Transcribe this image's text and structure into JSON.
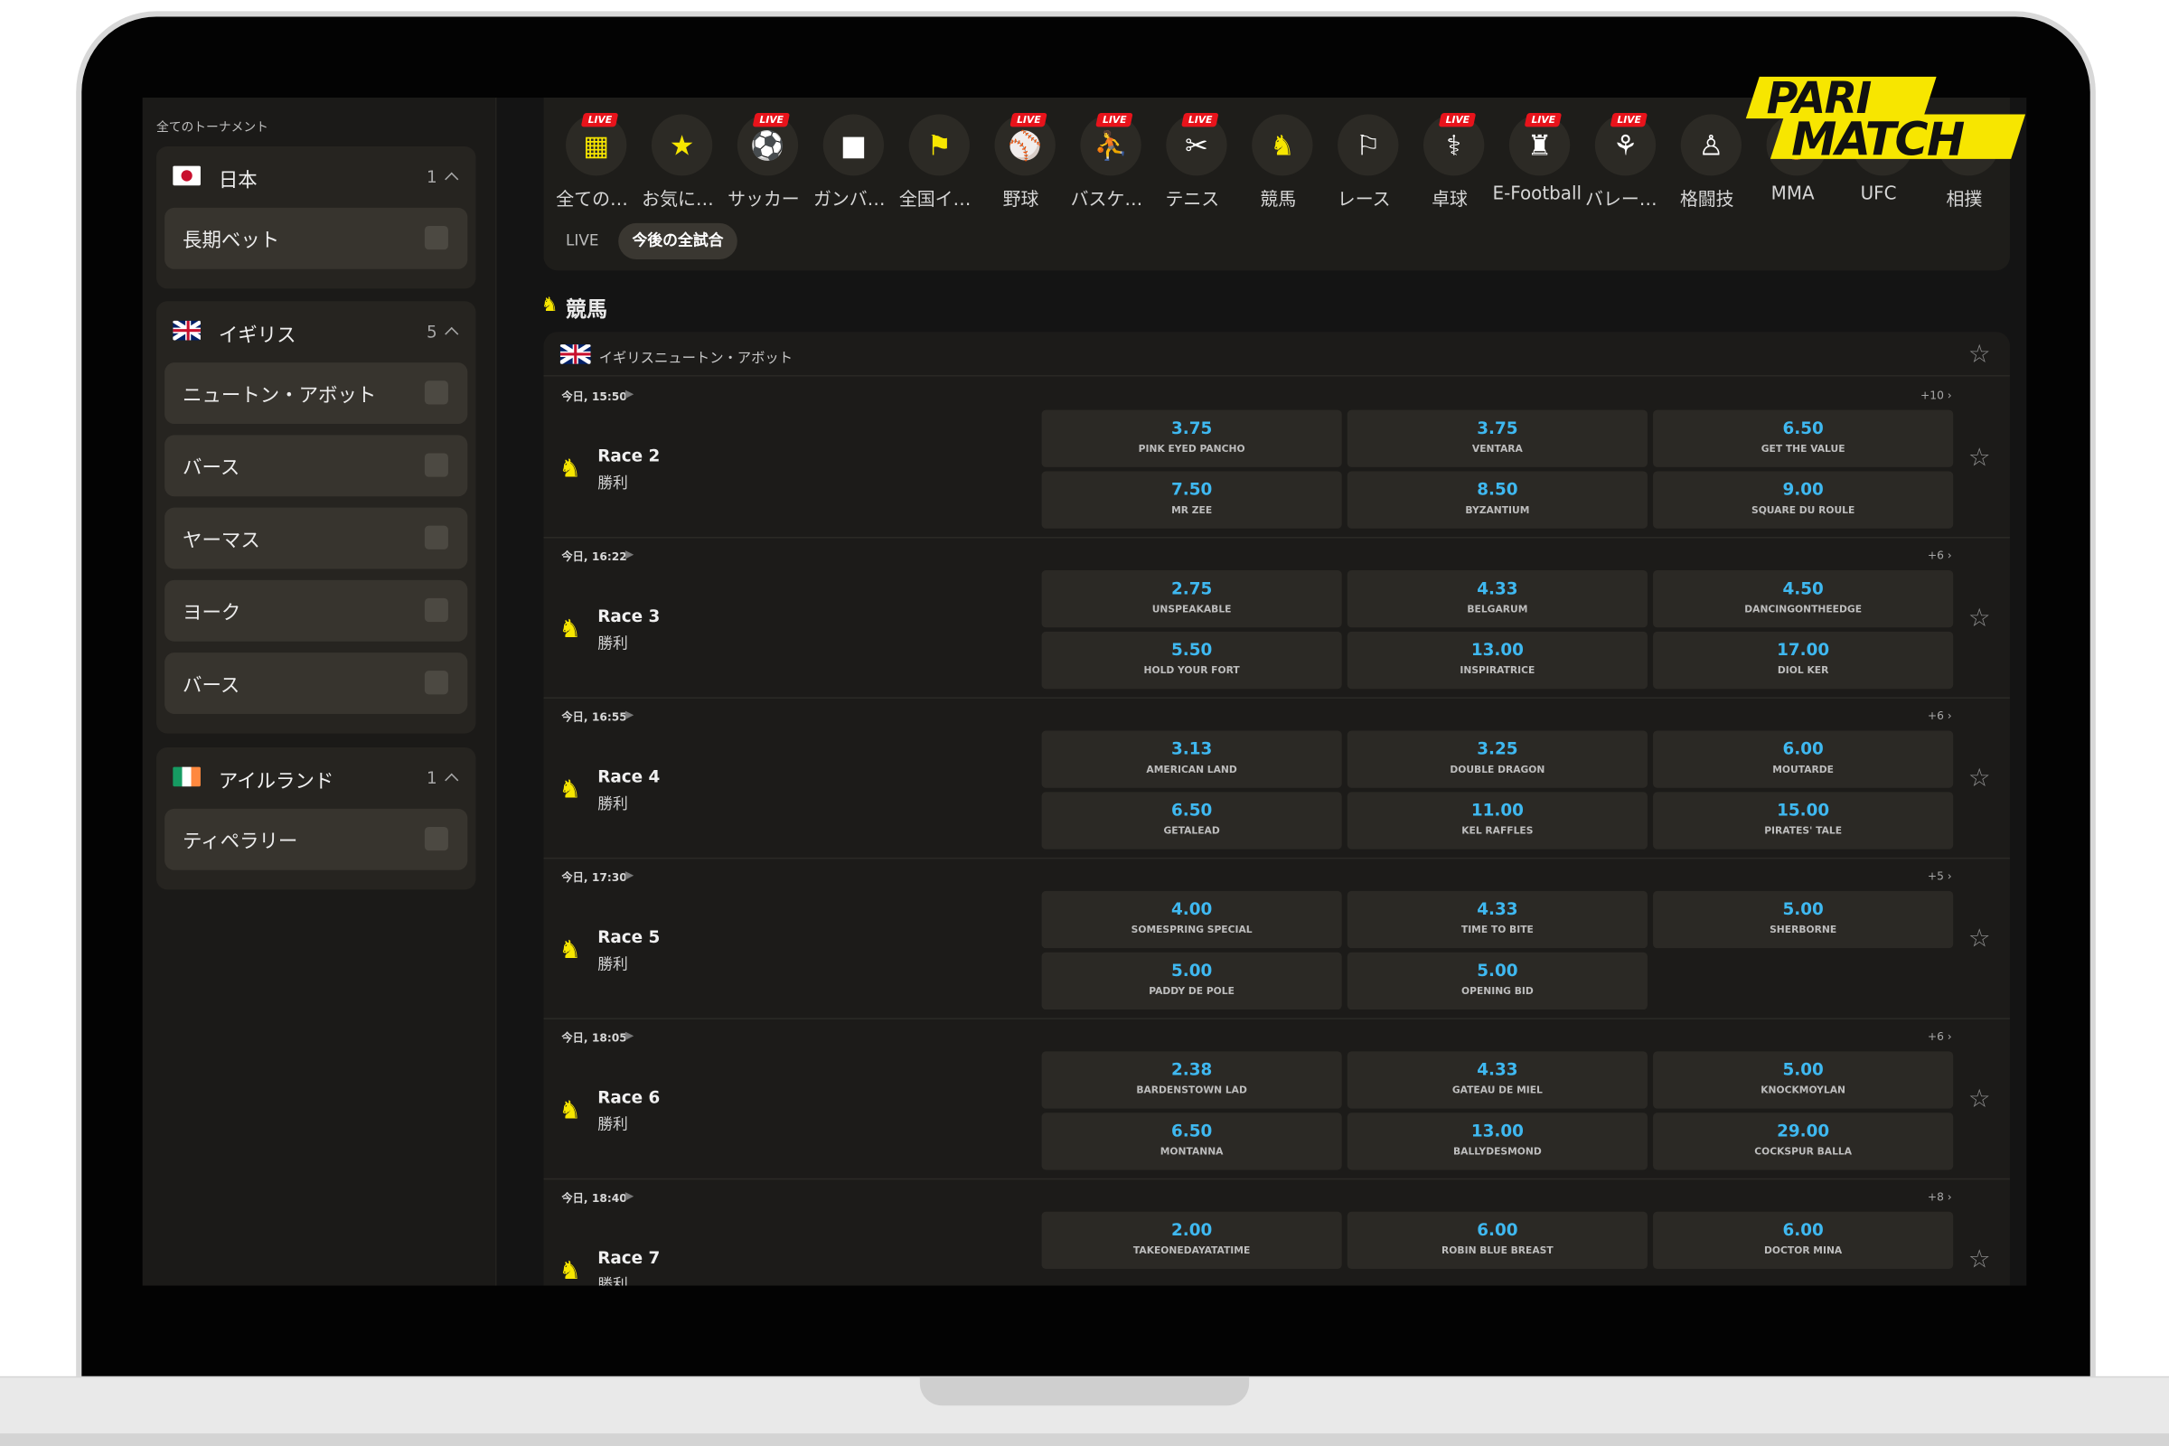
{
  "brand": {
    "name_line1": "PARI",
    "name_line2": "MATCH",
    "accent": "#f7e600"
  },
  "sidebar": {
    "title": "全てのトーナメント",
    "countries": [
      {
        "name": "日本",
        "count": "1",
        "flag": "jp-flag",
        "tournaments": [
          "長期ベット"
        ]
      },
      {
        "name": "イギリス",
        "count": "5",
        "flag": "uk-flag",
        "tournaments": [
          "ニュートン・アボット",
          "バース",
          "ヤーマス",
          "ヨーク",
          "バース"
        ]
      },
      {
        "name": "アイルランド",
        "count": "1",
        "flag": "ie-flag",
        "tournaments": [
          "ティペラリー"
        ]
      }
    ]
  },
  "sports": [
    {
      "label": "全ての…",
      "icon": "all-sports-icon",
      "live": "LIVE"
    },
    {
      "label": "お気に…",
      "icon": "favorites-icon"
    },
    {
      "label": "サッカー",
      "icon": "soccer-icon",
      "live": "LIVE"
    },
    {
      "label": "ガンバ…",
      "icon": "gamba-icon"
    },
    {
      "label": "全国イ…",
      "icon": "national-event-icon"
    },
    {
      "label": "野球",
      "icon": "baseball-icon",
      "live": "LIVE"
    },
    {
      "label": "バスケ…",
      "icon": "basketball-icon",
      "live": "LIVE"
    },
    {
      "label": "テニス",
      "icon": "tennis-icon",
      "live": "LIVE"
    },
    {
      "label": "競馬",
      "icon": "horse-racing-icon"
    },
    {
      "label": "レース",
      "icon": "racing-flag-icon"
    },
    {
      "label": "卓球",
      "icon": "table-tennis-icon",
      "live": "LIVE"
    },
    {
      "label": "E-Football",
      "icon": "efootball-icon",
      "live": "LIVE"
    },
    {
      "label": "バレー…",
      "icon": "volleyball-icon",
      "live": "LIVE"
    },
    {
      "label": "格闘技",
      "icon": "martial-arts-icon"
    },
    {
      "label": "MMA",
      "icon": "mma-icon"
    },
    {
      "label": "UFC",
      "icon": "ufc-icon"
    },
    {
      "label": "相撲",
      "icon": "sumo-icon"
    }
  ],
  "tabs": {
    "live": "LIVE",
    "upcoming": "今後の全試合"
  },
  "section": {
    "title": "競馬"
  },
  "league": {
    "name": "イギリスニュートン・アボット"
  },
  "events": [
    {
      "time": "今日, 15:50",
      "more": "+10 ›",
      "name": "Race 2",
      "type": "勝利",
      "odds": [
        {
          "price": "3.75",
          "runner": "PINK EYED PANCHO"
        },
        {
          "price": "3.75",
          "runner": "VENTARA"
        },
        {
          "price": "6.50",
          "runner": "GET THE VALUE"
        },
        {
          "price": "7.50",
          "runner": "MR ZEE"
        },
        {
          "price": "8.50",
          "runner": "BYZANTIUM"
        },
        {
          "price": "9.00",
          "runner": "SQUARE DU ROULE"
        }
      ]
    },
    {
      "time": "今日, 16:22",
      "more": "+6 ›",
      "name": "Race 3",
      "type": "勝利",
      "odds": [
        {
          "price": "2.75",
          "runner": "UNSPEAKABLE"
        },
        {
          "price": "4.33",
          "runner": "BELGARUM"
        },
        {
          "price": "4.50",
          "runner": "DANCINGONTHEEDGE"
        },
        {
          "price": "5.50",
          "runner": "HOLD YOUR FORT"
        },
        {
          "price": "13.00",
          "runner": "INSPIRATRICE"
        },
        {
          "price": "17.00",
          "runner": "DIOL KER"
        }
      ]
    },
    {
      "time": "今日, 16:55",
      "more": "+6 ›",
      "name": "Race 4",
      "type": "勝利",
      "odds": [
        {
          "price": "3.13",
          "runner": "AMERICAN LAND"
        },
        {
          "price": "3.25",
          "runner": "DOUBLE DRAGON"
        },
        {
          "price": "6.00",
          "runner": "MOUTARDE"
        },
        {
          "price": "6.50",
          "runner": "GETALEAD"
        },
        {
          "price": "11.00",
          "runner": "KEL RAFFLES"
        },
        {
          "price": "15.00",
          "runner": "PIRATES' TALE"
        }
      ]
    },
    {
      "time": "今日, 17:30",
      "more": "+5 ›",
      "name": "Race 5",
      "type": "勝利",
      "odds": [
        {
          "price": "4.00",
          "runner": "SOMESPRING SPECIAL"
        },
        {
          "price": "4.33",
          "runner": "TIME TO BITE"
        },
        {
          "price": "5.00",
          "runner": "SHERBORNE"
        },
        {
          "price": "5.00",
          "runner": "PADDY DE POLE"
        },
        {
          "price": "5.00",
          "runner": "OPENING BID"
        }
      ]
    },
    {
      "time": "今日, 18:05",
      "more": "+6 ›",
      "name": "Race 6",
      "type": "勝利",
      "odds": [
        {
          "price": "2.38",
          "runner": "BARDENSTOWN LAD"
        },
        {
          "price": "4.33",
          "runner": "GATEAU DE MIEL"
        },
        {
          "price": "5.00",
          "runner": "KNOCKMOYLAN"
        },
        {
          "price": "6.50",
          "runner": "MONTANNA"
        },
        {
          "price": "13.00",
          "runner": "BALLYDESMOND"
        },
        {
          "price": "29.00",
          "runner": "COCKSPUR BALLA"
        }
      ]
    },
    {
      "time": "今日, 18:40",
      "more": "+8 ›",
      "name": "Race 7",
      "type": "勝利",
      "odds": [
        {
          "price": "2.00",
          "runner": "TAKEONEDAYATATIME"
        },
        {
          "price": "6.00",
          "runner": "ROBIN BLUE BREAST"
        },
        {
          "price": "6.00",
          "runner": "DOCTOR MINA"
        }
      ]
    }
  ]
}
